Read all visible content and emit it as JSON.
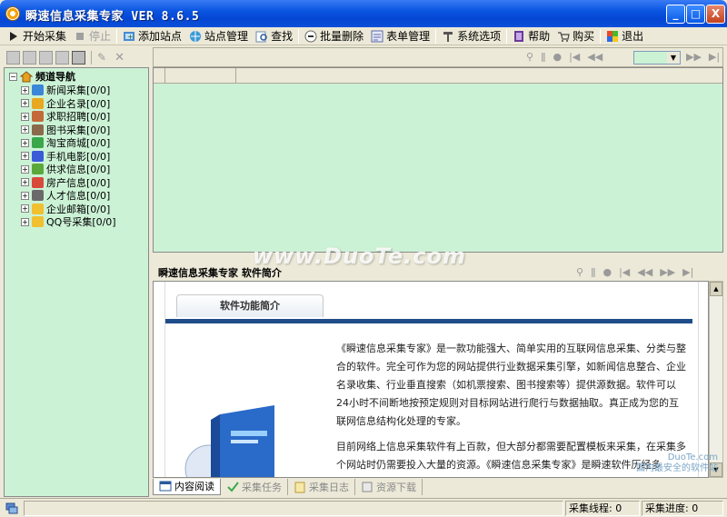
{
  "window": {
    "title": "瞬速信息采集专家 VER 8.6.5",
    "minimize_label": "_",
    "maximize_label": "□",
    "close_label": "X"
  },
  "toolbar": {
    "items": [
      {
        "label": "开始采集",
        "icon": "play-icon",
        "enabled": true
      },
      {
        "label": "停止",
        "icon": "stop-icon",
        "enabled": false
      },
      {
        "label": "添加站点",
        "icon": "add-site-icon",
        "enabled": true
      },
      {
        "label": "站点管理",
        "icon": "site-manage-icon",
        "enabled": true
      },
      {
        "label": "查找",
        "icon": "find-icon",
        "enabled": true
      },
      {
        "label": "批量删除",
        "icon": "batch-delete-icon",
        "enabled": true
      },
      {
        "label": "表单管理",
        "icon": "form-icon",
        "enabled": true
      },
      {
        "label": "系统选项",
        "icon": "options-icon",
        "enabled": true
      },
      {
        "label": "帮助",
        "icon": "help-icon",
        "enabled": true
      },
      {
        "label": "购买",
        "icon": "buy-icon",
        "enabled": true
      },
      {
        "label": "退出",
        "icon": "exit-icon",
        "enabled": true
      }
    ]
  },
  "tree": {
    "root": "频道导航",
    "items": [
      {
        "label": "新闻采集[0/0]",
        "color": "#3a86d8"
      },
      {
        "label": "企业名录[0/0]",
        "color": "#e8a820"
      },
      {
        "label": "求职招聘[0/0]",
        "color": "#c46a3a"
      },
      {
        "label": "图书采集[0/0]",
        "color": "#8a6a4a"
      },
      {
        "label": "淘宝商城[0/0]",
        "color": "#3aa84a"
      },
      {
        "label": "手机电影[0/0]",
        "color": "#3a5ad8"
      },
      {
        "label": "供求信息[0/0]",
        "color": "#5aa83a"
      },
      {
        "label": "房产信息[0/0]",
        "color": "#d84a3a"
      },
      {
        "label": "人才信息[0/0]",
        "color": "#6a6a6a"
      },
      {
        "label": "企业邮箱[0/0]",
        "color": "#f0c030"
      },
      {
        "label": "QQ号采集[0/0]",
        "color": "#f0c030"
      }
    ]
  },
  "preview": {
    "header": "瞬速信息采集专家 软件简介",
    "tab_title": "软件功能简介",
    "paragraph1": "《瞬速信息采集专家》是一款功能强大、简单实用的互联网信息采集、分类与整合的软件。完全可作为您的网站提供行业数据采集引擎，如新闻信息整合、企业名录收集、行业垂直搜索（如机票搜索、图书搜索等）提供源数据。软件可以24小时不间断地按预定规则对目标网站进行爬行与数据抽取。真正成为您的互联网信息结构化处理的专家。",
    "paragraph2": "目前网络上信息采集软件有上百款，但大部分都需要配置模板来采集，在采集多个网站时仍需要投入大量的资源。《瞬速信息采集专家》是瞬速软件历经多"
  },
  "bottom_tabs": [
    {
      "label": "内容阅读",
      "active": true
    },
    {
      "label": "采集任务",
      "active": false
    },
    {
      "label": "采集日志",
      "active": false
    },
    {
      "label": "资源下载",
      "active": false
    }
  ],
  "status": {
    "threads_label": "采集线程: 0",
    "progress_label": "采集进度: 0"
  },
  "watermark": {
    "main": "www.DuoTe.com",
    "corner_line1": "DuoTe.com",
    "corner_line2": "国内最安全的软件站"
  },
  "colors": {
    "titlebar": "#0a55e0",
    "panel_green": "#ccf2d6",
    "accent_blue_bar": "#1f4d8a"
  }
}
